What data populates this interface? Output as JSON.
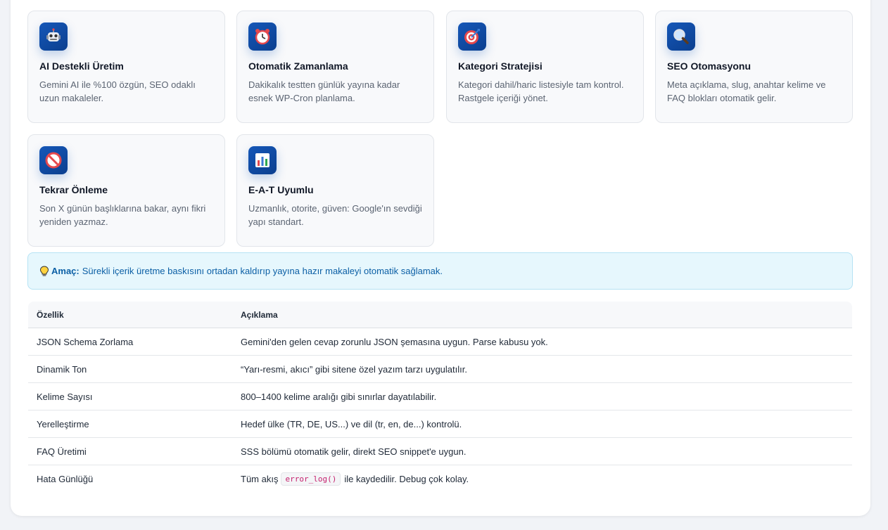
{
  "features": [
    {
      "icon": "robot-icon",
      "title": "AI Destekli Üretim",
      "desc": "Gemini AI ile %100 özgün, SEO odaklı uzun makaleler."
    },
    {
      "icon": "alarm-clock-icon",
      "title": "Otomatik Zamanlama",
      "desc": "Dakikalık testten günlük yayına kadar esnek WP-Cron planlama."
    },
    {
      "icon": "target-icon",
      "title": "Kategori Stratejisi",
      "desc": "Kategori dahil/haric listesiyle tam kontrol. Rastgele içeriği yönet."
    },
    {
      "icon": "magnifier-icon",
      "title": "SEO Otomasyonu",
      "desc": "Meta açıklama, slug, anahtar kelime ve FAQ blokları otomatik gelir."
    },
    {
      "icon": "no-entry-icon",
      "title": "Tekrar Önleme",
      "desc": "Son X günün başlıklarına bakar, aynı fikri yeniden yazmaz."
    },
    {
      "icon": "bar-chart-icon",
      "title": "E-A-T Uyumlu",
      "desc": "Uzmanlık, otorite, güven: Google'ın sevdiği yapı standart."
    }
  ],
  "note": {
    "icon": "lightbulb-icon",
    "label": "Amaç:",
    "text": "Sürekli içerik üretme baskısını ortadan kaldırıp yayına hazır makaleyi otomatik sağlamak."
  },
  "table": {
    "headers": [
      "Özellik",
      "Açıklama"
    ],
    "rows": [
      {
        "feature": "JSON Schema Zorlama",
        "desc": "Gemini'den gelen cevap zorunlu JSON şemasına uygun. Parse kabusu yok."
      },
      {
        "feature": "Dinamik Ton",
        "desc": "“Yarı-resmi, akıcı” gibi sitene özel yazım tarzı uygulatılır."
      },
      {
        "feature": "Kelime Sayısı",
        "desc": "800–1400 kelime aralığı gibi sınırlar dayatılabilir."
      },
      {
        "feature": "Yerelleştirme",
        "desc": "Hedef ülke (TR, DE, US...) ve dil (tr, en, de...) kontrolü."
      },
      {
        "feature": "FAQ Üretimi",
        "desc": "SSS bölümü otomatik gelir, direkt SEO snippet'e uygun."
      },
      {
        "feature": "Hata Günlüğü",
        "desc_before": "Tüm akış",
        "code": "error_log()",
        "desc_after": "ile kaydedilir. Debug çok kolay."
      }
    ]
  },
  "colors": {
    "icon_bg": "#1557b8",
    "note_bg": "#e6f7fd",
    "note_text": "#0b5fa5",
    "code_text": "#c5216e"
  }
}
